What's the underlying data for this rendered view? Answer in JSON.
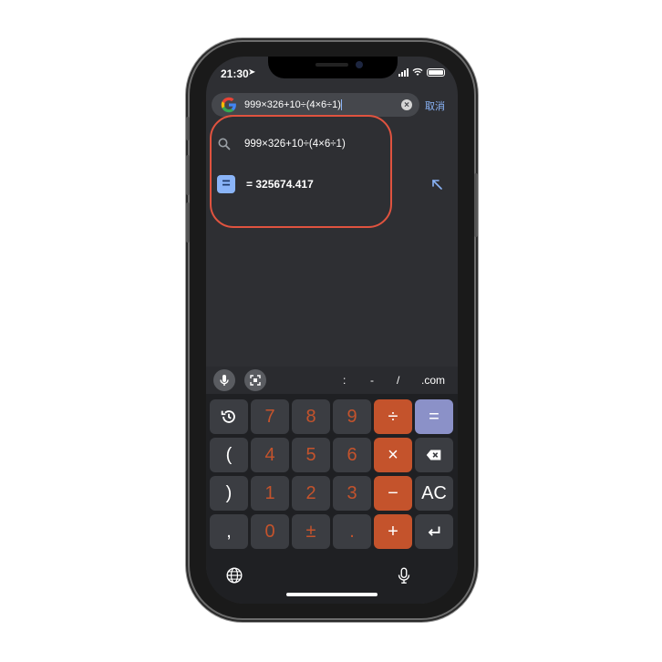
{
  "status": {
    "time": "21:30"
  },
  "search": {
    "query": "999×326+10÷(4×6÷1)",
    "cancel_label": "取消"
  },
  "suggestions": {
    "query_text": "999×326+10÷(4×6÷1)",
    "result_text": "= 325674.417"
  },
  "toolbar": {
    "colon": ":",
    "dash": "-",
    "slash": "/",
    "dotcom": ".com"
  },
  "keypad": {
    "rows": [
      [
        "7",
        "8",
        "9",
        "÷",
        "="
      ],
      [
        "(",
        "4",
        "5",
        "6",
        "×"
      ],
      [
        ")",
        "1",
        "2",
        "3",
        "−",
        "AC"
      ],
      [
        ",",
        "0",
        "±",
        ".",
        "+"
      ]
    ],
    "row1": {
      "k7": "7",
      "k8": "8",
      "k9": "9",
      "div": "÷",
      "eq": "="
    },
    "row2": {
      "lp": "(",
      "k4": "4",
      "k5": "5",
      "k6": "6",
      "mul": "×"
    },
    "row3": {
      "rp": ")",
      "k1": "1",
      "k2": "2",
      "k3": "3",
      "minus": "−",
      "ac": "AC"
    },
    "row4": {
      "comma": ",",
      "k0": "0",
      "pm": "±",
      "dot": ".",
      "plus": "+"
    }
  },
  "colors": {
    "accent": "#8ab4f8",
    "operator": "#c4532c",
    "equals": "#8b91c8",
    "highlight": "#e0533f"
  },
  "icons": [
    "google-logo",
    "search-icon",
    "clear-icon",
    "equals-icon",
    "fill-arrow-icon",
    "microphone-icon",
    "scan-icon",
    "history-icon",
    "backspace-icon",
    "enter-icon",
    "globe-icon"
  ]
}
